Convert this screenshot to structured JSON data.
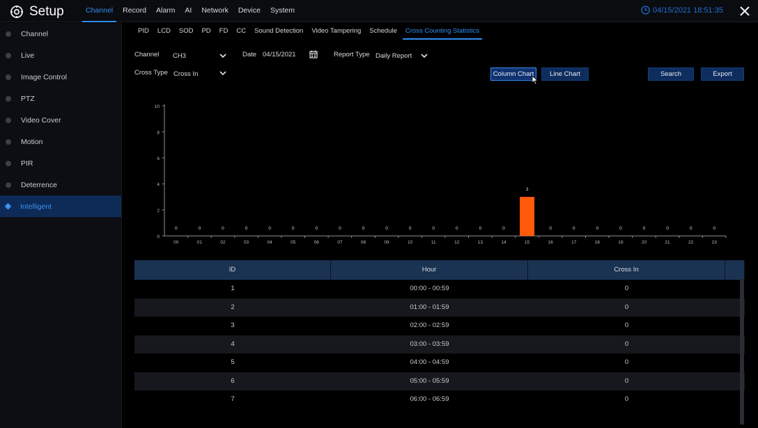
{
  "app": {
    "title": "Setup"
  },
  "top_nav": [
    {
      "label": "Channel",
      "active": true
    },
    {
      "label": "Record",
      "active": false
    },
    {
      "label": "Alarm",
      "active": false
    },
    {
      "label": "AI",
      "active": false
    },
    {
      "label": "Network",
      "active": false
    },
    {
      "label": "Device",
      "active": false
    },
    {
      "label": "System",
      "active": false
    }
  ],
  "clock": "04/15/2021 18:51:35",
  "sidebar": [
    {
      "label": "Channel",
      "active": false
    },
    {
      "label": "Live",
      "active": false
    },
    {
      "label": "Image Control",
      "active": false
    },
    {
      "label": "PTZ",
      "active": false
    },
    {
      "label": "Video Cover",
      "active": false
    },
    {
      "label": "Motion",
      "active": false
    },
    {
      "label": "PIR",
      "active": false
    },
    {
      "label": "Deterrence",
      "active": false
    },
    {
      "label": "Intelligent",
      "active": true
    }
  ],
  "sub_tabs": [
    {
      "label": "PID",
      "active": false
    },
    {
      "label": "LCD",
      "active": false
    },
    {
      "label": "SOD",
      "active": false
    },
    {
      "label": "PD",
      "active": false
    },
    {
      "label": "FD",
      "active": false
    },
    {
      "label": "CC",
      "active": false
    },
    {
      "label": "Sound Detection",
      "active": false
    },
    {
      "label": "Video Tampering",
      "active": false
    },
    {
      "label": "Schedule",
      "active": false
    },
    {
      "label": "Cross Counting Statistics",
      "active": true
    }
  ],
  "filters": {
    "channel_label": "Channel",
    "channel_value": "CH3",
    "date_label": "Date",
    "date_value": "04/15/2021",
    "report_type_label": "Report Type",
    "report_type_value": "Daily Report",
    "cross_type_label": "Cross Type",
    "cross_type_value": "Cross In"
  },
  "buttons": {
    "column_chart": "Column Chart",
    "line_chart": "Line Chart",
    "search": "Search",
    "export": "Export"
  },
  "chart_data": {
    "type": "bar",
    "categories": [
      "00",
      "01",
      "02",
      "03",
      "04",
      "05",
      "06",
      "07",
      "08",
      "09",
      "10",
      "11",
      "12",
      "13",
      "14",
      "15",
      "16",
      "17",
      "18",
      "19",
      "20",
      "21",
      "22",
      "23"
    ],
    "values": [
      0,
      0,
      0,
      0,
      0,
      0,
      0,
      0,
      0,
      0,
      0,
      0,
      0,
      0,
      0,
      3,
      0,
      0,
      0,
      0,
      0,
      0,
      0,
      0
    ],
    "ylim": [
      0,
      10
    ],
    "yticks": [
      0,
      2,
      4,
      6,
      8,
      10
    ],
    "bar_color": "#ff5a0a",
    "grid": false
  },
  "table": {
    "headers": [
      "ID",
      "Hour",
      "Cross In"
    ],
    "rows": [
      [
        "1",
        "00:00 - 00:59",
        "0"
      ],
      [
        "2",
        "01:00 - 01:59",
        "0"
      ],
      [
        "3",
        "02:00 - 02:59",
        "0"
      ],
      [
        "4",
        "03:00 - 03:59",
        "0"
      ],
      [
        "5",
        "04:00 - 04:59",
        "0"
      ],
      [
        "6",
        "05:00 - 05:59",
        "0"
      ],
      [
        "7",
        "06:00 - 06:59",
        "0"
      ]
    ]
  },
  "colors": {
    "accent": "#2f8ff2",
    "bar": "#ff5a0a",
    "active_sidebar_bg": "#0e2a57"
  }
}
